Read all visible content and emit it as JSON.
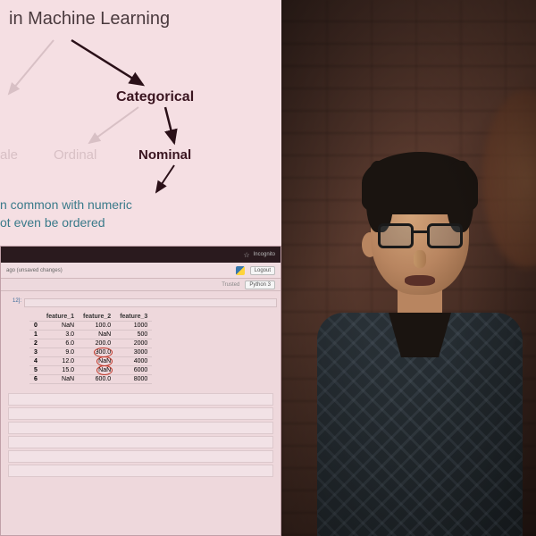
{
  "slide": {
    "title_fragment": "in Machine Learning",
    "tree": {
      "root_visible": "Categorical",
      "left_faded": "ale",
      "mid_faded": "Ordinal",
      "right": "Nominal"
    },
    "desc_line1": "n common with numeric",
    "desc_line2": "ot even be ordered"
  },
  "browser": {
    "mode": "Incognito",
    "star": "☆"
  },
  "notebook": {
    "file_status": "ago (unsaved changes)",
    "logout": "Logout",
    "trusted": "Trusted",
    "kernel": "Python 3",
    "input_prompt": "12]:",
    "table": {
      "cols": [
        "",
        "feature_1",
        "feature_2",
        "feature_3"
      ],
      "rows": [
        [
          "0",
          "NaN",
          "100.0",
          "1000"
        ],
        [
          "1",
          "3.0",
          "NaN",
          "500"
        ],
        [
          "2",
          "6.0",
          "200.0",
          "2000"
        ],
        [
          "3",
          "9.0",
          "300.0",
          "3000"
        ],
        [
          "4",
          "12.0",
          "NaN",
          "4000"
        ],
        [
          "5",
          "15.0",
          "NaN",
          "6000"
        ],
        [
          "6",
          "NaN",
          "600.0",
          "8000"
        ]
      ],
      "circled": [
        [
          3,
          2
        ],
        [
          4,
          2
        ],
        [
          5,
          2
        ]
      ]
    }
  }
}
